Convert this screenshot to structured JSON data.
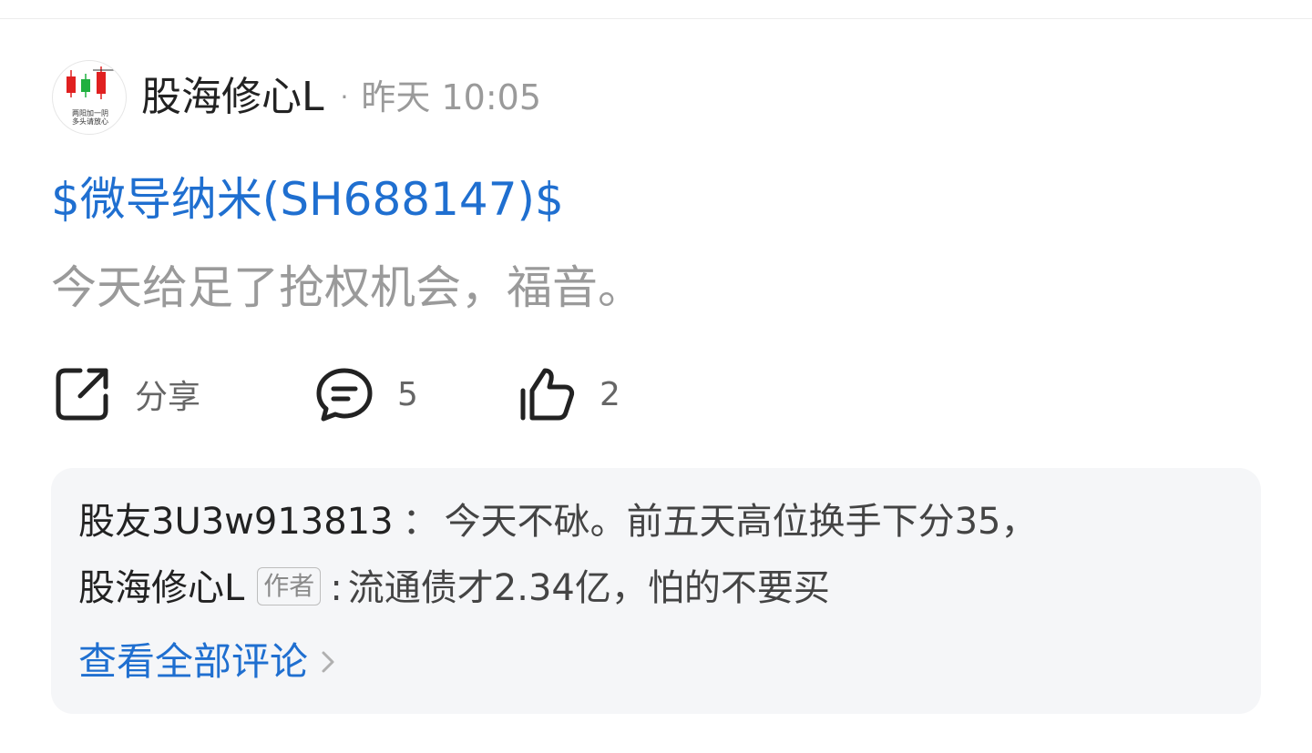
{
  "post": {
    "author": "股海修心L",
    "separator": "·",
    "time": "昨天 10:05",
    "stock_tag": "$微导纳米(SH688147)$",
    "text": "今天给足了抢权机会，福音。",
    "avatar_caption_line1": "两阳加一阴",
    "avatar_caption_line2": "多头请放心"
  },
  "actions": {
    "share_label": "分享",
    "comment_count": "5",
    "like_count": "2",
    "share_icon": "share-icon",
    "comment_icon": "comment-icon",
    "like_icon": "thumbs-up-icon"
  },
  "comments": {
    "items": [
      {
        "name": "股友3U3w913813",
        "colon": "：",
        "text": "今天不砅。前五天高位换手下分35，"
      },
      {
        "name": "股海修心L",
        "badge": "作者",
        "colon": ":",
        "text": "流通债才2.34亿，怕的不要买"
      }
    ],
    "view_all": "查看全部评论"
  },
  "colors": {
    "link_blue": "#1f6fd0",
    "muted_gray": "#9a9a9a",
    "box_bg": "#f5f6f8",
    "candle_red": "#e02020",
    "candle_green": "#20b040"
  }
}
